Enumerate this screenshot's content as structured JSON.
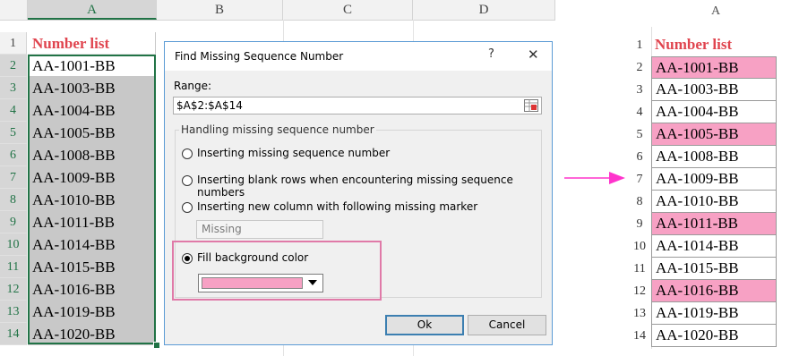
{
  "left_sheet": {
    "columns": [
      "A",
      "B",
      "C",
      "D"
    ],
    "rows": [
      "1",
      "2",
      "3",
      "4",
      "5",
      "6",
      "7",
      "8",
      "9",
      "10",
      "11",
      "12",
      "13",
      "14"
    ],
    "cells": [
      "Number list",
      "AA-1001-BB",
      "AA-1003-BB",
      "AA-1004-BB",
      "AA-1005-BB",
      "AA-1008-BB",
      "AA-1009-BB",
      "AA-1010-BB",
      "AA-1011-BB",
      "AA-1014-BB",
      "AA-1015-BB",
      "AA-1016-BB",
      "AA-1019-BB",
      "AA-1020-BB"
    ]
  },
  "dialog": {
    "title": "Find Missing Sequence Number",
    "help_glyph": "?",
    "close_glyph": "✕",
    "range_label": "Range:",
    "range_value": "$A$2:$A$14",
    "group_label": "Handling missing sequence number",
    "options": [
      "Inserting missing sequence number",
      "Inserting blank rows when encountering missing sequence numbers",
      "Inserting new column with following missing marker",
      "Fill background color"
    ],
    "selected_option": 3,
    "marker_value": "Missing",
    "fill_color": "#f7a1c4",
    "ok_label": "Ok",
    "cancel_label": "Cancel"
  },
  "right_sheet": {
    "column": "A",
    "rows": [
      "1",
      "2",
      "3",
      "4",
      "5",
      "6",
      "7",
      "8",
      "9",
      "10",
      "11",
      "12",
      "13",
      "14"
    ],
    "cells": [
      "Number list",
      "AA-1001-BB",
      "AA-1003-BB",
      "AA-1004-BB",
      "AA-1005-BB",
      "AA-1008-BB",
      "AA-1009-BB",
      "AA-1010-BB",
      "AA-1011-BB",
      "AA-1014-BB",
      "AA-1015-BB",
      "AA-1016-BB",
      "AA-1019-BB",
      "AA-1020-BB"
    ],
    "highlighted": [
      1,
      4,
      8,
      11
    ],
    "highlight_color": "#f7a1c4"
  },
  "colors": {
    "title_red": "#e0454f",
    "excel_green": "#217346",
    "arrow_magenta": "#ff33cc",
    "highlight_box": "#e07aa8"
  }
}
